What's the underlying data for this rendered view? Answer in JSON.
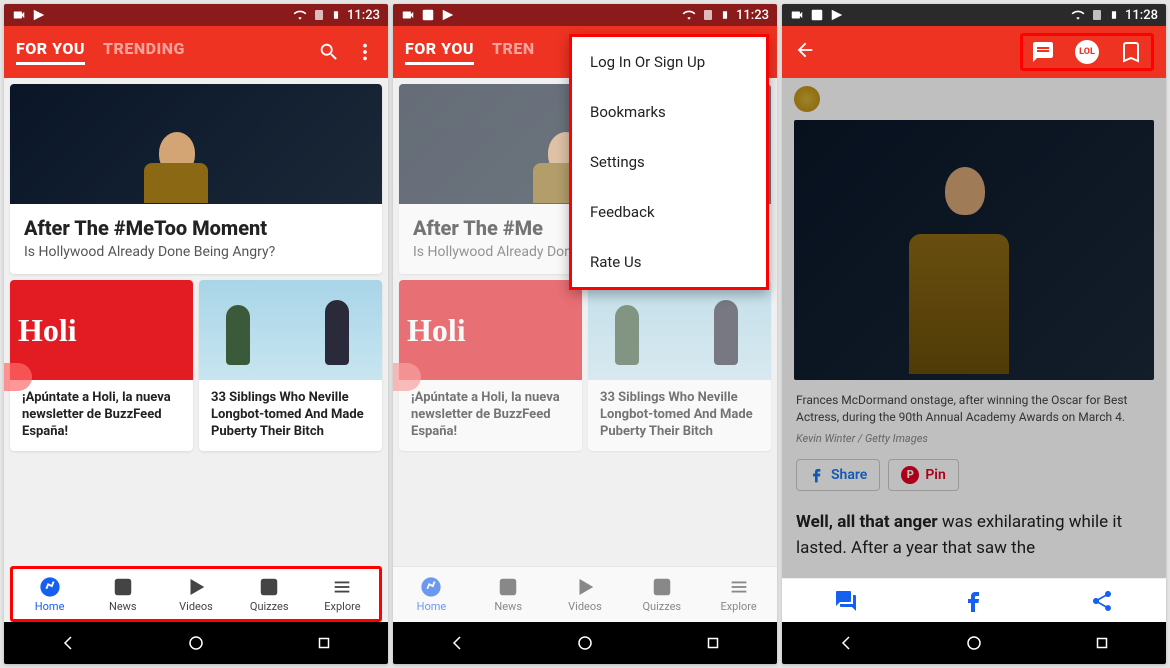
{
  "screen1": {
    "status": {
      "time": "11:23"
    },
    "tabs": {
      "for_you": "FOR YOU",
      "trending": "TRENDING"
    },
    "hero": {
      "title": "After The #MeToo Moment",
      "subtitle": "Is Hollywood Already Done Being Angry?"
    },
    "cards": {
      "holi": {
        "logo": "Holi",
        "title": "¡Apúntate a Holi, la nueva newsletter de BuzzFeed España!"
      },
      "siblings": {
        "title": "33 Siblings Who Neville Longbot-tomed And Made Puberty Their Bitch"
      }
    },
    "nav": {
      "home": "Home",
      "news": "News",
      "videos": "Videos",
      "quizzes": "Quizzes",
      "explore": "Explore"
    }
  },
  "screen2": {
    "status": {
      "time": "11:23"
    },
    "tabs": {
      "for_you": "FOR YOU",
      "trending": "TREN"
    },
    "menu": {
      "login": "Log In Or Sign Up",
      "bookmarks": "Bookmarks",
      "settings": "Settings",
      "feedback": "Feedback",
      "rate": "Rate Us"
    },
    "hero": {
      "title": "After The #Me",
      "subtitle": "Is Hollywood Already Done Being Angry?"
    },
    "cards": {
      "holi": {
        "logo": "Holi",
        "title": "¡Apúntate a Holi, la nueva newsletter de BuzzFeed España!"
      },
      "siblings": {
        "title": "33 Siblings Who Neville Longbot-tomed And Made Puberty Their Bitch"
      }
    },
    "nav": {
      "home": "Home",
      "news": "News",
      "videos": "Videos",
      "quizzes": "Quizzes",
      "explore": "Explore"
    }
  },
  "screen3": {
    "status": {
      "time": "11:28"
    },
    "caption": "Frances McDormand onstage, after winning the Oscar for Best Actress, during the 90th Annual Academy Awards on March 4.",
    "credit": "Kevin Winter / Getty Images",
    "share": {
      "share_label": "Share",
      "pin_label": "Pin"
    },
    "body_strong": "Well, all that anger",
    "body_rest": " was exhilarating while it lasted. After a year that saw the",
    "lol": "LOL"
  }
}
